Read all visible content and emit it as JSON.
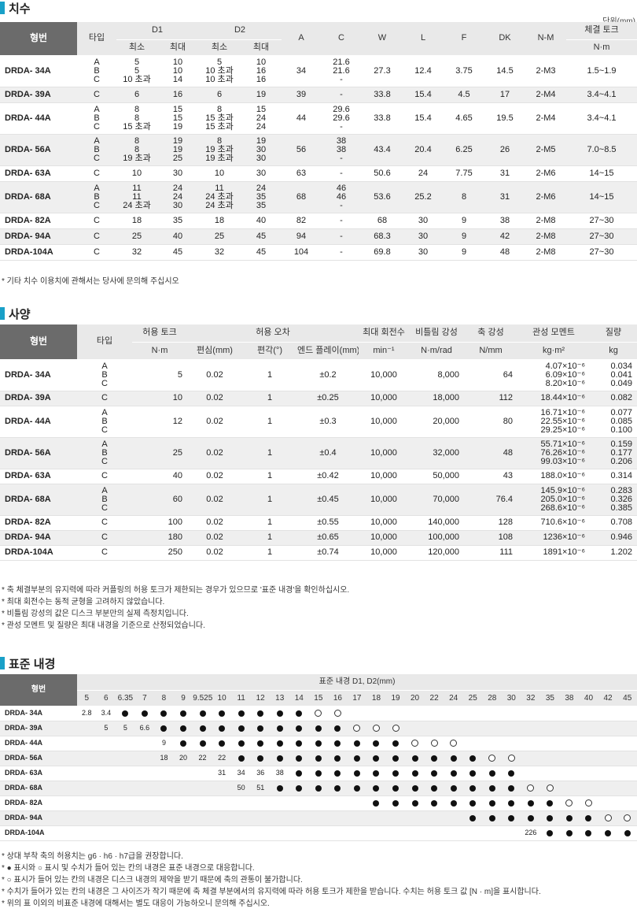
{
  "dimensions": {
    "title": "치수",
    "unit": "단위(mm)",
    "headers": {
      "model": "형번",
      "type": "타입",
      "d1": "D1",
      "d2": "D2",
      "min": "최소",
      "max": "최대",
      "a": "A",
      "c": "C",
      "w": "W",
      "l": "L",
      "f": "F",
      "dk": "DK",
      "nm": "N-M",
      "torque": "체결 토크",
      "torque_unit": "N·m"
    },
    "rows": [
      {
        "model": "DRDA- 34A",
        "types": [
          "A",
          "B",
          "C"
        ],
        "d1min": [
          "5",
          "5",
          "10 초과"
        ],
        "d1max": [
          "10",
          "10",
          "14"
        ],
        "d2min": [
          "5",
          "10 초과",
          "10 초과"
        ],
        "d2max": [
          "10",
          "16",
          "16"
        ],
        "a": "34",
        "c": [
          "21.6",
          "21.6",
          "-"
        ],
        "w": "27.3",
        "l": "12.4",
        "f": "3.75",
        "dk": "14.5",
        "nm": "2-M3",
        "torque": "1.5~1.9"
      },
      {
        "model": "DRDA- 39A",
        "types": [
          "C"
        ],
        "d1min": [
          "6"
        ],
        "d1max": [
          "16"
        ],
        "d2min": [
          "6"
        ],
        "d2max": [
          "19"
        ],
        "a": "39",
        "c": [
          "-"
        ],
        "w": "33.8",
        "l": "15.4",
        "f": "4.5",
        "dk": "17",
        "nm": "2-M4",
        "torque": "3.4~4.1"
      },
      {
        "model": "DRDA- 44A",
        "types": [
          "A",
          "B",
          "C"
        ],
        "d1min": [
          "8",
          "8",
          "15 초과"
        ],
        "d1max": [
          "15",
          "15",
          "19"
        ],
        "d2min": [
          "8",
          "15 초과",
          "15 초과"
        ],
        "d2max": [
          "15",
          "24",
          "24"
        ],
        "a": "44",
        "c": [
          "29.6",
          "29.6",
          "-"
        ],
        "w": "33.8",
        "l": "15.4",
        "f": "4.65",
        "dk": "19.5",
        "nm": "2-M4",
        "torque": "3.4~4.1"
      },
      {
        "model": "DRDA- 56A",
        "types": [
          "A",
          "B",
          "C"
        ],
        "d1min": [
          "8",
          "8",
          "19 초과"
        ],
        "d1max": [
          "19",
          "19",
          "25"
        ],
        "d2min": [
          "8",
          "19 초과",
          "19 초과"
        ],
        "d2max": [
          "19",
          "30",
          "30"
        ],
        "a": "56",
        "c": [
          "38",
          "38",
          "-"
        ],
        "w": "43.4",
        "l": "20.4",
        "f": "6.25",
        "dk": "26",
        "nm": "2-M5",
        "torque": "7.0~8.5"
      },
      {
        "model": "DRDA- 63A",
        "types": [
          "C"
        ],
        "d1min": [
          "10"
        ],
        "d1max": [
          "30"
        ],
        "d2min": [
          "10"
        ],
        "d2max": [
          "30"
        ],
        "a": "63",
        "c": [
          "-"
        ],
        "w": "50.6",
        "l": "24",
        "f": "7.75",
        "dk": "31",
        "nm": "2-M6",
        "torque": "14~15"
      },
      {
        "model": "DRDA- 68A",
        "types": [
          "A",
          "B",
          "C"
        ],
        "d1min": [
          "11",
          "11",
          "24 초과"
        ],
        "d1max": [
          "24",
          "24",
          "30"
        ],
        "d2min": [
          "11",
          "24 초과",
          "24 초과"
        ],
        "d2max": [
          "24",
          "35",
          "35"
        ],
        "a": "68",
        "c": [
          "46",
          "46",
          "-"
        ],
        "w": "53.6",
        "l": "25.2",
        "f": "8",
        "dk": "31",
        "nm": "2-M6",
        "torque": "14~15"
      },
      {
        "model": "DRDA- 82A",
        "types": [
          "C"
        ],
        "d1min": [
          "18"
        ],
        "d1max": [
          "35"
        ],
        "d2min": [
          "18"
        ],
        "d2max": [
          "40"
        ],
        "a": "82",
        "c": [
          "-"
        ],
        "w": "68",
        "l": "30",
        "f": "9",
        "dk": "38",
        "nm": "2-M8",
        "torque": "27~30"
      },
      {
        "model": "DRDA- 94A",
        "types": [
          "C"
        ],
        "d1min": [
          "25"
        ],
        "d1max": [
          "40"
        ],
        "d2min": [
          "25"
        ],
        "d2max": [
          "45"
        ],
        "a": "94",
        "c": [
          "-"
        ],
        "w": "68.3",
        "l": "30",
        "f": "9",
        "dk": "42",
        "nm": "2-M8",
        "torque": "27~30"
      },
      {
        "model": "DRDA-104A",
        "types": [
          "C"
        ],
        "d1min": [
          "32"
        ],
        "d1max": [
          "45"
        ],
        "d2min": [
          "32"
        ],
        "d2max": [
          "45"
        ],
        "a": "104",
        "c": [
          "-"
        ],
        "w": "69.8",
        "l": "30",
        "f": "9",
        "dk": "48",
        "nm": "2-M8",
        "torque": "27~30"
      }
    ],
    "notes": [
      "* 기타 치수 이용치에 관해서는 당사에 문의해 주십시오"
    ]
  },
  "spec": {
    "title": "사양",
    "headers": {
      "model": "형번",
      "type": "타입",
      "torque": "허용 토크",
      "torque_unit": "N·m",
      "error": "허용 오차",
      "ecc": "편심(mm)",
      "ang": "편각(°)",
      "endplay": "엔드 플레이(mm)",
      "speed": "최대 회전수",
      "speed_unit": "min⁻¹",
      "tors": "비틀림 강성",
      "tors_unit": "N·m/rad",
      "axial": "축 강성",
      "axial_unit": "N/mm",
      "inertia": "관성 모멘트",
      "inertia_unit": "kg·m²",
      "mass": "질량",
      "mass_unit": "kg"
    },
    "rows": [
      {
        "model": "DRDA- 34A",
        "types": [
          "A",
          "B",
          "C"
        ],
        "torque": "5",
        "ecc": "0.02",
        "ang": "1",
        "endplay": "±0.2",
        "speed": "10,000",
        "tors": "8,000",
        "axial": "64",
        "inertia": [
          "4.07×10⁻⁶",
          "6.09×10⁻⁶",
          "8.20×10⁻⁶"
        ],
        "mass": [
          "0.034",
          "0.041",
          "0.049"
        ]
      },
      {
        "model": "DRDA- 39A",
        "types": [
          "C"
        ],
        "torque": "10",
        "ecc": "0.02",
        "ang": "1",
        "endplay": "±0.25",
        "speed": "10,000",
        "tors": "18,000",
        "axial": "112",
        "inertia": [
          "18.44×10⁻⁶"
        ],
        "mass": [
          "0.082"
        ]
      },
      {
        "model": "DRDA- 44A",
        "types": [
          "A",
          "B",
          "C"
        ],
        "torque": "12",
        "ecc": "0.02",
        "ang": "1",
        "endplay": "±0.3",
        "speed": "10,000",
        "tors": "20,000",
        "axial": "80",
        "inertia": [
          "16.71×10⁻⁶",
          "22.55×10⁻⁶",
          "29.25×10⁻⁶"
        ],
        "mass": [
          "0.077",
          "0.085",
          "0.100"
        ]
      },
      {
        "model": "DRDA- 56A",
        "types": [
          "A",
          "B",
          "C"
        ],
        "torque": "25",
        "ecc": "0.02",
        "ang": "1",
        "endplay": "±0.4",
        "speed": "10,000",
        "tors": "32,000",
        "axial": "48",
        "inertia": [
          "55.71×10⁻⁶",
          "76.26×10⁻⁶",
          "99.03×10⁻⁶"
        ],
        "mass": [
          "0.159",
          "0.177",
          "0.206"
        ]
      },
      {
        "model": "DRDA- 63A",
        "types": [
          "C"
        ],
        "torque": "40",
        "ecc": "0.02",
        "ang": "1",
        "endplay": "±0.42",
        "speed": "10,000",
        "tors": "50,000",
        "axial": "43",
        "inertia": [
          "188.0×10⁻⁶"
        ],
        "mass": [
          "0.314"
        ]
      },
      {
        "model": "DRDA- 68A",
        "types": [
          "A",
          "B",
          "C"
        ],
        "torque": "60",
        "ecc": "0.02",
        "ang": "1",
        "endplay": "±0.45",
        "speed": "10,000",
        "tors": "70,000",
        "axial": "76.4",
        "inertia": [
          "145.9×10⁻⁶",
          "205.0×10⁻⁶",
          "268.6×10⁻⁶"
        ],
        "mass": [
          "0.283",
          "0.326",
          "0.385"
        ]
      },
      {
        "model": "DRDA- 82A",
        "types": [
          "C"
        ],
        "torque": "100",
        "ecc": "0.02",
        "ang": "1",
        "endplay": "±0.55",
        "speed": "10,000",
        "tors": "140,000",
        "axial": "128",
        "inertia": [
          "710.6×10⁻⁶"
        ],
        "mass": [
          "0.708"
        ]
      },
      {
        "model": "DRDA- 94A",
        "types": [
          "C"
        ],
        "torque": "180",
        "ecc": "0.02",
        "ang": "1",
        "endplay": "±0.65",
        "speed": "10,000",
        "tors": "100,000",
        "axial": "108",
        "inertia": [
          "1236×10⁻⁶"
        ],
        "mass": [
          "0.946"
        ]
      },
      {
        "model": "DRDA-104A",
        "types": [
          "C"
        ],
        "torque": "250",
        "ecc": "0.02",
        "ang": "1",
        "endplay": "±0.74",
        "speed": "10,000",
        "tors": "120,000",
        "axial": "111",
        "inertia": [
          "1891×10⁻⁶"
        ],
        "mass": [
          "1.202"
        ]
      }
    ],
    "notes": [
      "* 축 체결부분의 유지력에 따라 커플링의 허용 토크가 제한되는 경우가 있으므로 '표준 내경'을 확인하십시오.",
      "* 최대 회전수는 동적 균형을 고려하지 않았습니다.",
      "* 비틀림 강성의 값은 디스크 부분만의 실제 측정치입니다.",
      "* 관성 모멘트 및 질량은 최대 내경을 기준으로 산정되었습니다."
    ]
  },
  "bore": {
    "title": "표준 내경",
    "headers": {
      "model": "형번",
      "group": "표준 내경 D1, D2(mm)"
    },
    "sizes": [
      "5",
      "6",
      "6.35",
      "7",
      "8",
      "9",
      "9.525",
      "10",
      "11",
      "12",
      "13",
      "14",
      "15",
      "16",
      "17",
      "18",
      "19",
      "20",
      "22",
      "24",
      "25",
      "28",
      "30",
      "32",
      "35",
      "38",
      "40",
      "42",
      "45"
    ],
    "rows": [
      {
        "model": "DRDA- 34A",
        "cells": [
          "2.8",
          "3.4",
          "●",
          "●",
          "●",
          "●",
          "●",
          "●",
          "●",
          "●",
          "●",
          "●",
          "○",
          "○",
          "",
          "",
          "",
          "",
          "",
          "",
          "",
          "",
          "",
          "",
          "",
          "",
          "",
          "",
          ""
        ]
      },
      {
        "model": "DRDA- 39A",
        "cells": [
          "",
          "5",
          "5",
          "6.6",
          "●",
          "●",
          "●",
          "●",
          "●",
          "●",
          "●",
          "●",
          "●",
          "●",
          "○",
          "○",
          "○",
          "",
          "",
          "",
          "",
          "",
          "",
          "",
          "",
          "",
          "",
          "",
          ""
        ]
      },
      {
        "model": "DRDA- 44A",
        "cells": [
          "",
          "",
          "",
          "",
          "9",
          "●",
          "●",
          "●",
          "●",
          "●",
          "●",
          "●",
          "●",
          "●",
          "●",
          "●",
          "●",
          "○",
          "○",
          "○",
          "",
          "",
          "",
          "",
          "",
          "",
          "",
          "",
          ""
        ]
      },
      {
        "model": "DRDA- 56A",
        "cells": [
          "",
          "",
          "",
          "",
          "18",
          "20",
          "22",
          "22",
          "●",
          "●",
          "●",
          "●",
          "●",
          "●",
          "●",
          "●",
          "●",
          "●",
          "●",
          "●",
          "●",
          "○",
          "○",
          "",
          "",
          "",
          "",
          "",
          ""
        ]
      },
      {
        "model": "DRDA- 63A",
        "cells": [
          "",
          "",
          "",
          "",
          "",
          "",
          "",
          "31",
          "34",
          "36",
          "38",
          "●",
          "●",
          "●",
          "●",
          "●",
          "●",
          "●",
          "●",
          "●",
          "●",
          "●",
          "●",
          "",
          "",
          "",
          "",
          "",
          ""
        ]
      },
      {
        "model": "DRDA- 68A",
        "cells": [
          "",
          "",
          "",
          "",
          "",
          "",
          "",
          "",
          "50",
          "51",
          "●",
          "●",
          "●",
          "●",
          "●",
          "●",
          "●",
          "●",
          "●",
          "●",
          "●",
          "●",
          "●",
          "○",
          "○",
          "",
          "",
          "",
          ""
        ]
      },
      {
        "model": "DRDA- 82A",
        "cells": [
          "",
          "",
          "",
          "",
          "",
          "",
          "",
          "",
          "",
          "",
          "",
          "",
          "",
          "",
          "",
          "●",
          "●",
          "●",
          "●",
          "●",
          "●",
          "●",
          "●",
          "●",
          "●",
          "○",
          "○",
          "",
          ""
        ]
      },
      {
        "model": "DRDA- 94A",
        "cells": [
          "",
          "",
          "",
          "",
          "",
          "",
          "",
          "",
          "",
          "",
          "",
          "",
          "",
          "",
          "",
          "",
          "",
          "",
          "",
          "",
          "●",
          "●",
          "●",
          "●",
          "●",
          "●",
          "●",
          "○",
          "○"
        ]
      },
      {
        "model": "DRDA-104A",
        "cells": [
          "",
          "",
          "",
          "",
          "",
          "",
          "",
          "",
          "",
          "",
          "",
          "",
          "",
          "",
          "",
          "",
          "",
          "",
          "",
          "",
          "",
          "",
          "",
          "226",
          "●",
          "●",
          "●",
          "●",
          "●"
        ]
      }
    ],
    "notes": [
      "* 상대 부착 축의 허용치는 g6 · h6 · h7급을 권장합니다.",
      "* ● 표시와 ○ 표시 및 수치가 들어 있는 칸의 내경은 표준 내경으로 대응합니다.",
      "* ○ 표시가 들어 있는 칸의 내경은 디스크 내경의 제약을 받기 때문에 축의 관통이 불가합니다.",
      "* 수치가 들어가 있는 칸의 내경은 그 사이즈가 작기 때문에 축 체결 부분에서의 유지력에 따라 허용 토크가 제한을 받습니다. 수치는 허용 토크 값 [N · m]을 표시합니다.",
      "* 위의 표 이외의 비표준 내경에 대해서는 별도 대응이 가능하오니 문의해 주십시오."
    ]
  },
  "colors": {
    "accent": "#19a0c8",
    "header_dark": "#6b6b6b",
    "header_light": "#e9e9e9",
    "row_alt": "#efefef"
  }
}
